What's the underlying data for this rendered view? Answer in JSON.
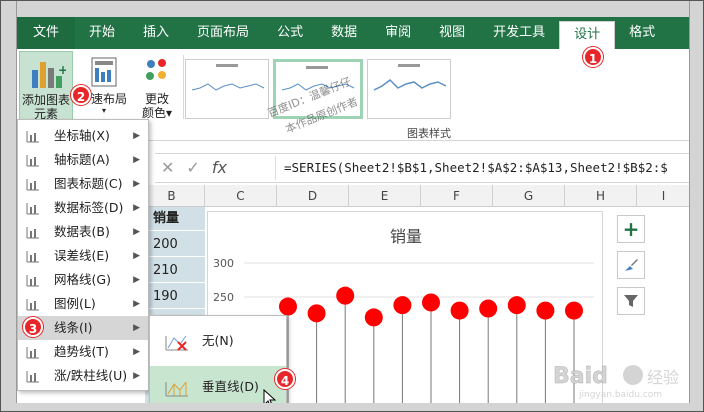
{
  "tabs": [
    "文件",
    "开始",
    "插入",
    "页面布局",
    "公式",
    "数据",
    "审阅",
    "视图",
    "开发工具",
    "设计",
    "格式"
  ],
  "ribbon": {
    "add_chart_element": "添加图表",
    "add_chart_element2": "元素",
    "quick_layout": "快速布局",
    "quick_layout_short": "速布局",
    "change_colors": "更改",
    "change_colors2": "颜色",
    "chart_styles_group": "图表样式"
  },
  "formula": {
    "fx": "fx",
    "value": "=SERIES(Sheet2!$B$1,Sheet2!$A$2:$A$13,Sheet2!$B$2:$"
  },
  "columns": [
    "B",
    "C",
    "D",
    "E",
    "F",
    "G",
    "H",
    "I"
  ],
  "cells": [
    "销量",
    "200",
    "210",
    "190"
  ],
  "menu_items": [
    {
      "label": "坐标轴(X)",
      "arrow": "▶"
    },
    {
      "label": "轴标题(A)",
      "arrow": "▶"
    },
    {
      "label": "图表标题(C)",
      "arrow": "▶"
    },
    {
      "label": "数据标签(D)",
      "arrow": "▶"
    },
    {
      "label": "数据表(B)",
      "arrow": "▶"
    },
    {
      "label": "误差线(E)",
      "arrow": "▶"
    },
    {
      "label": "网格线(G)",
      "arrow": "▶"
    },
    {
      "label": "图例(L)",
      "arrow": "▶"
    },
    {
      "label": "线条(I)",
      "arrow": "▶"
    },
    {
      "label": "趋势线(T)",
      "arrow": "▶"
    },
    {
      "label": "涨/跌柱线(U)",
      "arrow": "▶"
    }
  ],
  "submenu_items": [
    {
      "label": "无(N)"
    },
    {
      "label": "垂直线(D)"
    }
  ],
  "badges": [
    "1",
    "2",
    "3",
    "4"
  ],
  "watermarks": [
    "百度ID：温馨仔仔",
    "本作品原创作者"
  ],
  "chart_data": {
    "type": "scatter",
    "title": "销量",
    "y_ticks": [
      "300",
      "250"
    ],
    "ylim": [
      0,
      300
    ],
    "values": [
      236,
      226,
      252,
      220,
      238,
      242,
      230,
      233,
      238,
      230,
      230
    ],
    "marker_color": "#ff0000"
  },
  "colors": {
    "accent": "#217346",
    "badge": "#e8262a"
  }
}
